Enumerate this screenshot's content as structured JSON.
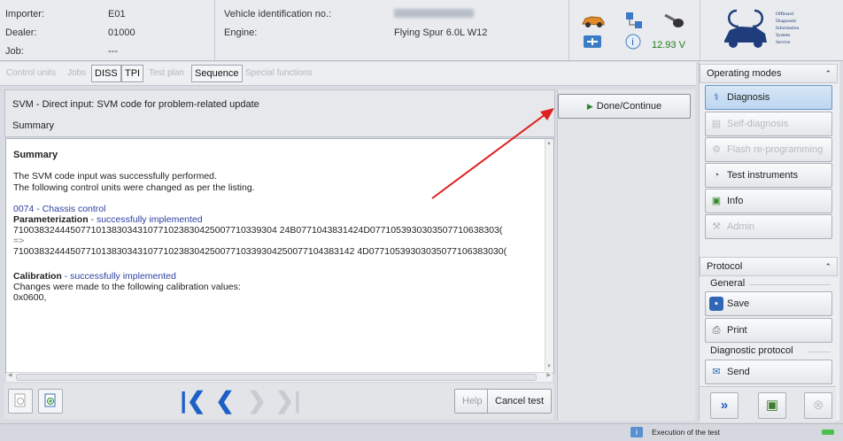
{
  "header": {
    "importer_label": "Importer:",
    "importer_value": "E01",
    "dealer_label": "Dealer:",
    "dealer_value": "01000",
    "job_label": "Job:",
    "job_value": "---",
    "vin_label": "Vehicle identification no.:",
    "engine_label": "Engine:",
    "engine_value": "Flying Spur 6.0L W12",
    "voltage": "12.93 V"
  },
  "logo": {
    "lines": [
      "Offboard",
      "Diagnostic",
      "Information",
      "System",
      "Service"
    ]
  },
  "tabs": [
    {
      "label": "Control units",
      "active": false
    },
    {
      "label": "Jobs",
      "active": false
    },
    {
      "label": "DISS",
      "active": true
    },
    {
      "label": "TPI",
      "active": true
    },
    {
      "label": "Test plan",
      "active": false
    },
    {
      "label": "Sequence",
      "active": true
    },
    {
      "label": "Special functions",
      "active": false
    }
  ],
  "panel": {
    "title": "SVM - Direct input: SVM code for problem-related update",
    "subtitle": "Summary"
  },
  "done_button": "Done/Continue",
  "content": {
    "heading": "Summary",
    "line1": "The SVM code input was successfully performed.",
    "line2": "The following control units were changed as per the listing.",
    "cu": "0074 - Chassis control",
    "param_label": "Parameterization",
    "param_status": " - successfully implemented",
    "code1": "710038324445077101383034310771023830425007710339304 24B0771043831424D0771053930303507710638303(",
    "arrow": "=>",
    "code2": "710038324445077101383034310771023830425007710339304250077104383142 4D07710539303035077106383030(",
    "calib_label": "Calibration",
    "calib_status": " - successfully implemented",
    "calib_text": "Changes were made to the following calibration values:",
    "calib_value": "0x0600,"
  },
  "toolbar": {
    "help": "Help",
    "cancel": "Cancel test"
  },
  "sidebar": {
    "operating_modes": "Operating modes",
    "modes": [
      {
        "label": "Diagnosis",
        "state": "selected"
      },
      {
        "label": "Self-diagnosis",
        "state": "disabled"
      },
      {
        "label": "Flash re-programming",
        "state": "disabled"
      },
      {
        "label": "Test instruments",
        "state": "enabled"
      },
      {
        "label": "Info",
        "state": "enabled"
      },
      {
        "label": "Admin",
        "state": "disabled"
      }
    ],
    "protocol": "Protocol",
    "general": "General",
    "save": "Save",
    "print": "Print",
    "diagnostic_protocol": "Diagnostic protocol",
    "send": "Send"
  },
  "status": {
    "text": "Execution of the test"
  },
  "colors": {
    "accent_blue": "#1c5fc6",
    "link_blue": "#2c3fa0",
    "arrow_red": "#e02020",
    "voltage_green": "#1d7a1d"
  }
}
